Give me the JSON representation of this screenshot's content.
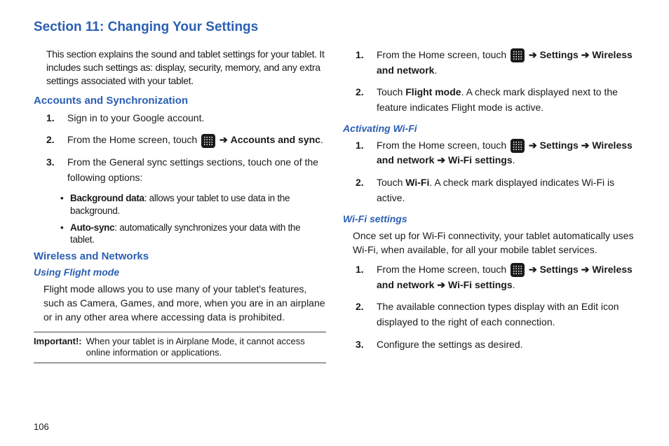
{
  "title": "Section 11: Changing Your Settings",
  "pageNumber": "106",
  "arrow": "➔",
  "col1": {
    "intro": "This section explains the sound and tablet settings for your tablet. It includes such settings as: display, security, memory, and any extra settings associated with your tablet.",
    "accounts": {
      "heading": "Accounts and Synchronization",
      "step1": "Sign in to your Google account.",
      "step2_pre": "From the Home screen, touch ",
      "step2_post_bold": "Accounts and sync",
      "step3": "From the General sync settings sections, touch one of the following options:",
      "bullet1_label": "Background data",
      "bullet1_text": ": allows your tablet to use data in the background.",
      "bullet2_label": "Auto-sync",
      "bullet2_text": ": automatically synchronizes your data with the tablet."
    },
    "wireless": {
      "heading": "Wireless and Networks",
      "sub1": "Using Flight mode",
      "para": "Flight mode allows you to use many of your tablet's features, such as Camera, Games, and more, when you are in an airplane or in any other area where accessing data is prohibited."
    },
    "important": {
      "label": "Important!:",
      "text": "When your tablet is in Airplane Mode, it cannot access online information or applications."
    }
  },
  "col2": {
    "flight": {
      "step1_pre": "From the Home screen, touch ",
      "step1_b1": "Settings",
      "step1_b2": "Wireless and network",
      "step2_pre": "Touch ",
      "step2_b": "Flight mode",
      "step2_post": ". A check mark displayed next to the feature indicates Flight mode is active."
    },
    "wifi_act": {
      "heading": "Activating Wi-Fi",
      "step1_pre": "From the Home screen, touch ",
      "step1_b1": "Settings",
      "step1_b2": "Wireless and network",
      "step1_b3": "Wi-Fi settings",
      "step2_pre": "Touch ",
      "step2_b": "Wi-Fi",
      "step2_post": ". A check mark displayed indicates Wi-Fi is active."
    },
    "wifi_set": {
      "heading": "Wi-Fi settings",
      "para": "Once set up for Wi-Fi connectivity, your tablet automatically uses Wi-Fi, when available, for all your mobile tablet services.",
      "step1_pre": "From the Home screen, touch ",
      "step1_b1": "Settings",
      "step1_b2": "Wireless and network",
      "step1_b3": "Wi-Fi settings",
      "step2": "The available connection types display with an Edit icon displayed to the right of each connection.",
      "step3": "Configure the settings as desired."
    }
  }
}
